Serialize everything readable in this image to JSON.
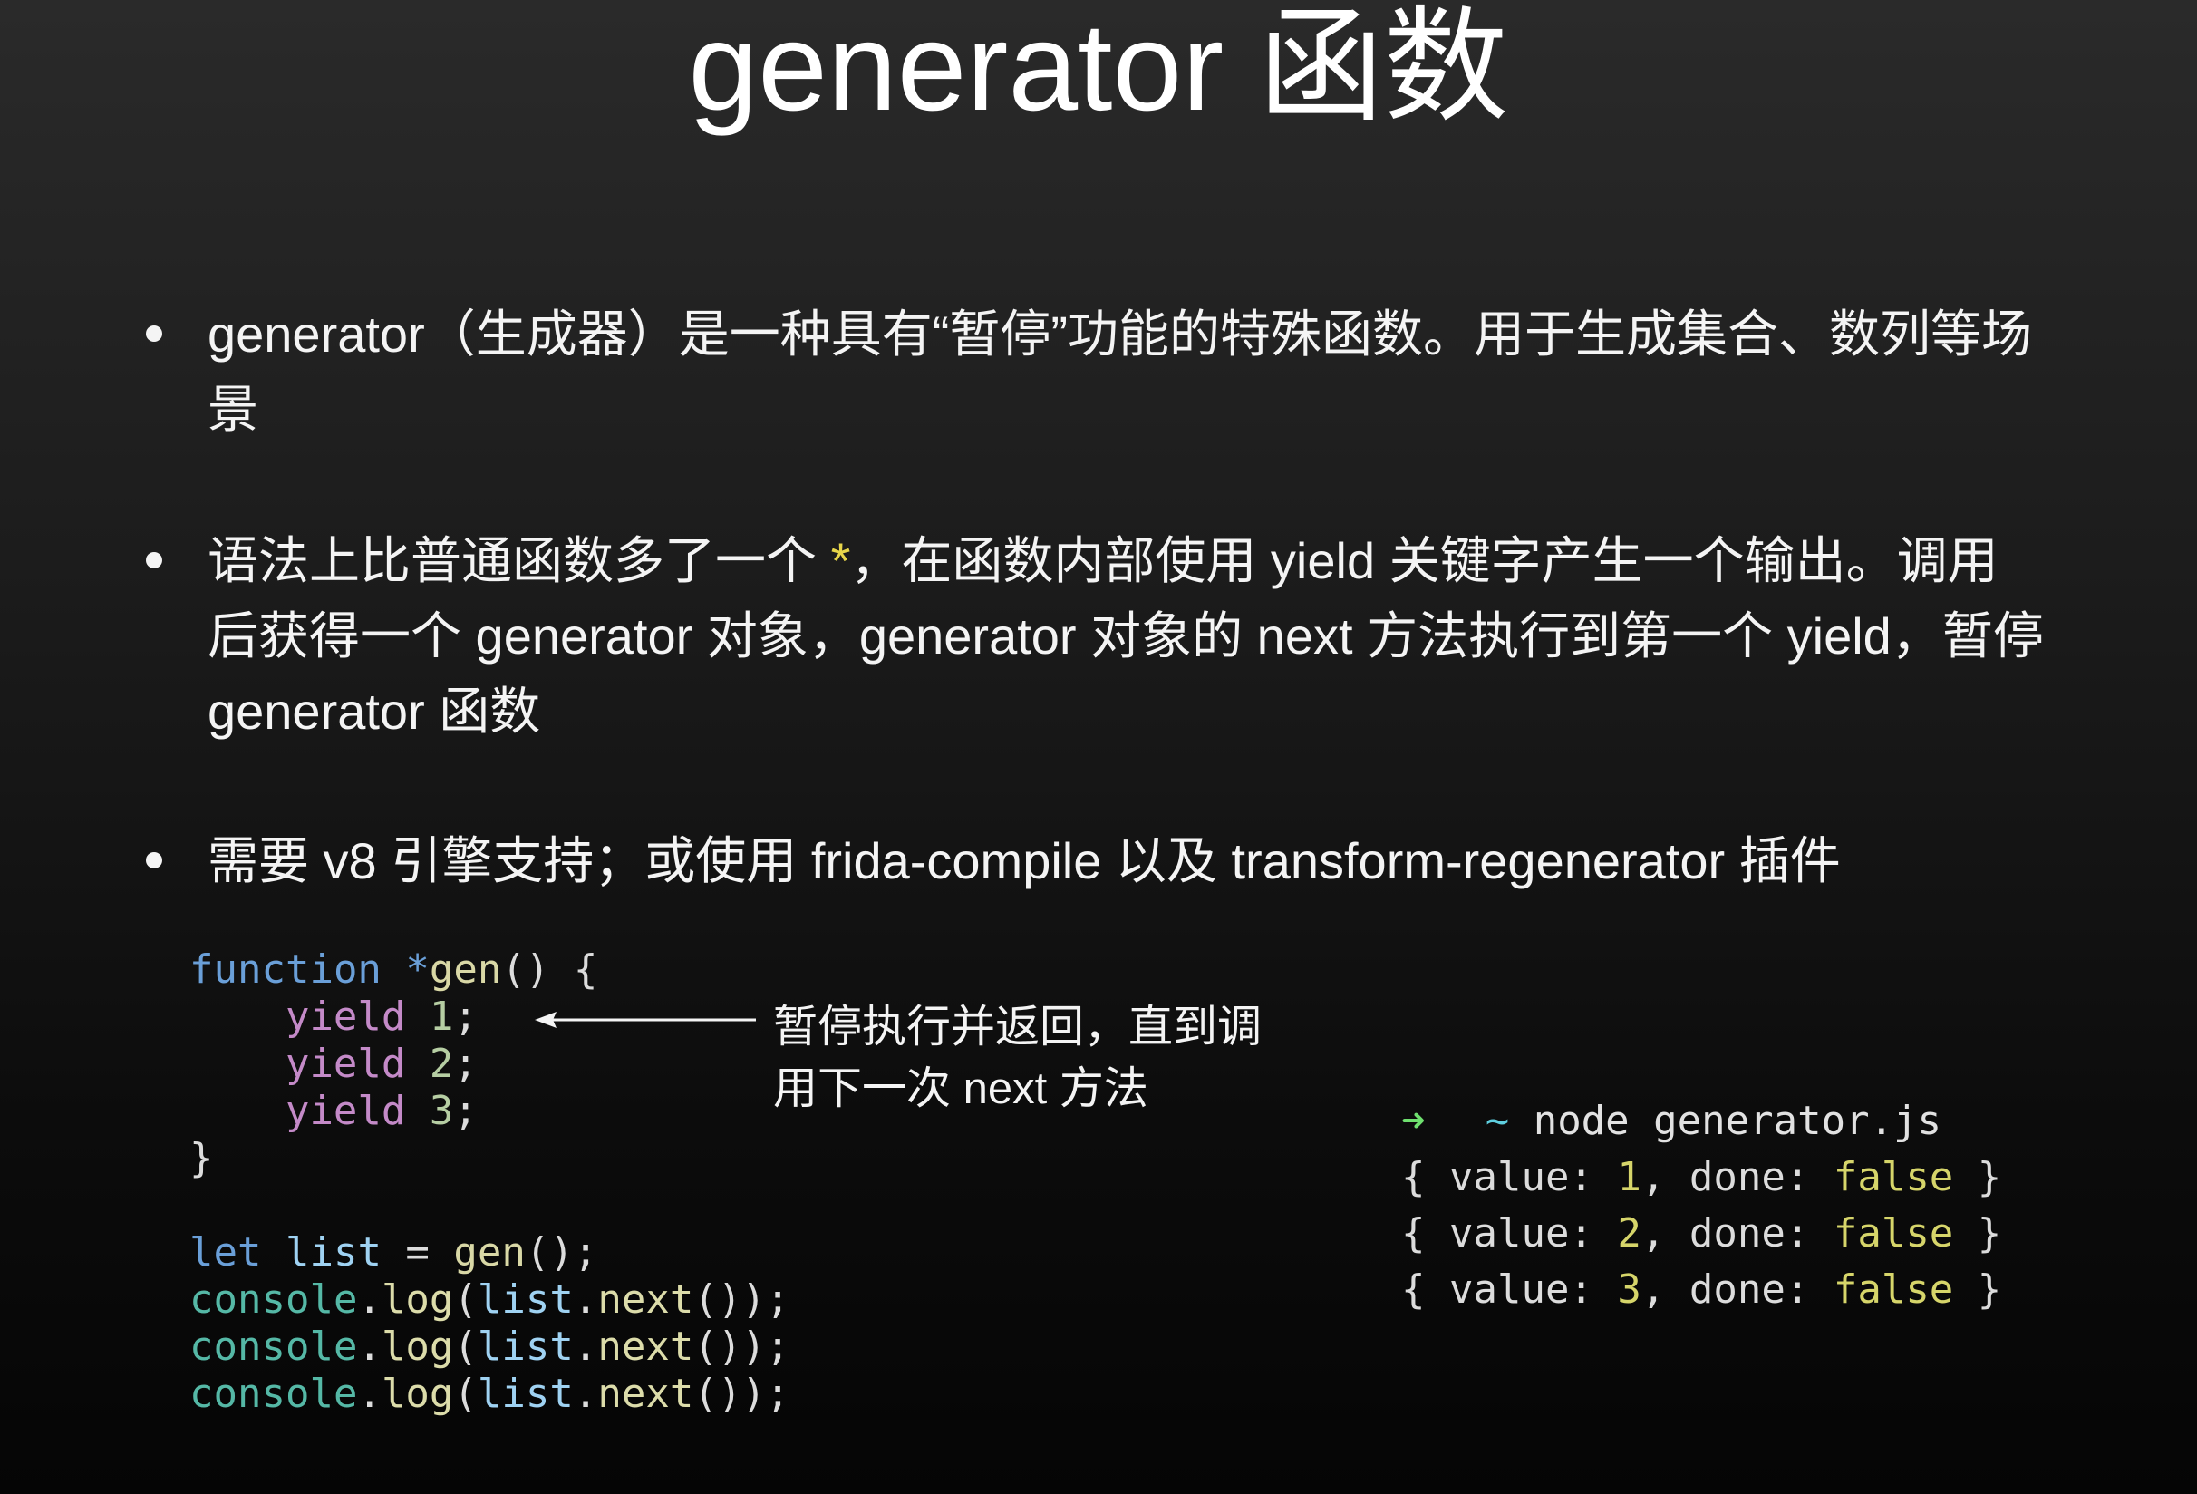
{
  "slide": {
    "title": "generator 函数",
    "bullets": [
      {
        "text": "generator（生成器）是一种具有“暂停”功能的特殊函数。用于生成集合、数列等场景"
      },
      {
        "before": "语法上比普通函数多了一个 ",
        "highlight": "*",
        "after": "，在函数内部使用 yield 关键字产生一个输出。调用后获得一个 generator 对象，generator 对象的 next 方法执行到第一个 yield，暂停 generator 函数"
      },
      {
        "text": "需要 v8 引擎支持；或使用 frida-compile 以及 transform-regenerator 插件"
      }
    ]
  },
  "code": {
    "lines": [
      [
        "function *",
        "gen",
        "() {"
      ],
      [
        "yield",
        " 1",
        ";"
      ],
      [
        "yield",
        " 2",
        ";"
      ],
      [
        "yield",
        " 3",
        ";"
      ],
      [
        "}"
      ],
      [],
      [
        "let",
        " list",
        " = ",
        "gen",
        "();"
      ],
      [
        "console",
        ".",
        "log",
        "(",
        "list",
        ".",
        "next",
        "());"
      ],
      [
        "console",
        ".",
        "log",
        "(",
        "list",
        ".",
        "next",
        "());"
      ],
      [
        "console",
        ".",
        "log",
        "(",
        "list",
        ".",
        "next",
        "());"
      ]
    ]
  },
  "annotation": {
    "text": "暂停执行并返回，直到调用下一次 next 方法"
  },
  "terminal": {
    "prompt": {
      "arrow": "➜",
      "cwd": "~",
      "command": "node generator.js"
    },
    "output": [
      [
        "{ value: ",
        "1",
        ", done: ",
        "false",
        " }"
      ],
      [
        "{ value: ",
        "2",
        ", done: ",
        "false",
        " }"
      ],
      [
        "{ value: ",
        "3",
        ", done: ",
        "false",
        " }"
      ]
    ]
  },
  "colors": {
    "text": "#f4f4f4",
    "keyword": "#6a9fd8",
    "function_name": "#d9d8a6",
    "yield": "#c48ac8",
    "number": "#b6cea3",
    "variable": "#9fd2f2",
    "object": "#55b8a6",
    "method": "#dcdcaa",
    "punctuation": "#dcdcdc",
    "highlight": "#e7d54a",
    "prompt_arrow": "#6fe06f",
    "prompt_cwd": "#5fcfdf",
    "terminal_value": "#d6d56a"
  }
}
